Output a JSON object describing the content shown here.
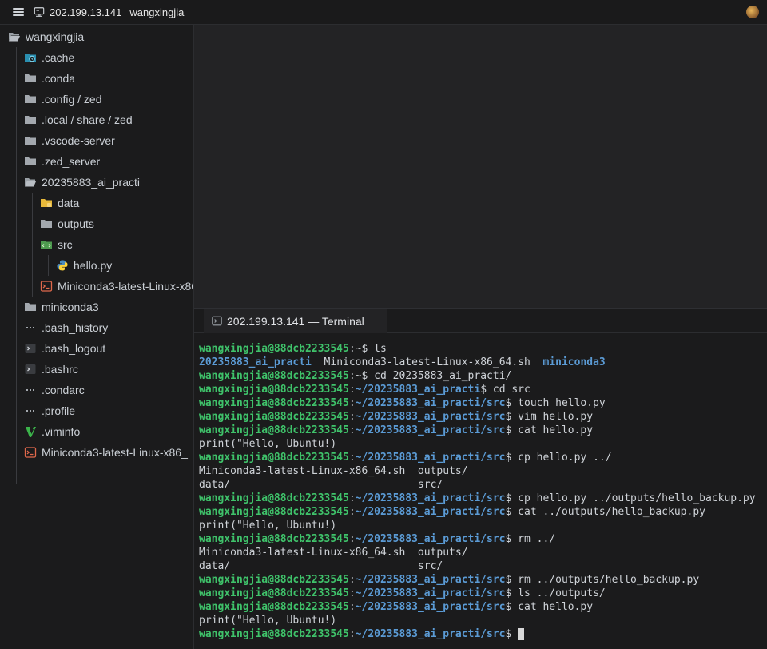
{
  "titlebar": {
    "host": "202.199.13.141",
    "user": "wangxingjia"
  },
  "sidebar": {
    "root": "wangxingjia",
    "items": [
      {
        "label": ".cache",
        "icon": "cache-folder-icon"
      },
      {
        "label": ".conda",
        "icon": "folder-icon"
      },
      {
        "label": ".config / zed",
        "icon": "folder-icon"
      },
      {
        "label": ".local / share / zed",
        "icon": "folder-icon"
      },
      {
        "label": ".vscode-server",
        "icon": "folder-icon"
      },
      {
        "label": ".zed_server",
        "icon": "folder-icon"
      },
      {
        "label": "20235883_ai_practi",
        "icon": "folder-open-icon"
      },
      {
        "label": "data",
        "icon": "data-folder-icon"
      },
      {
        "label": "outputs",
        "icon": "folder-icon"
      },
      {
        "label": "src",
        "icon": "src-folder-icon"
      },
      {
        "label": "hello.py",
        "icon": "python-icon"
      },
      {
        "label": "Miniconda3-latest-Linux-x86",
        "icon": "shell-script-icon"
      },
      {
        "label": "miniconda3",
        "icon": "folder-icon"
      },
      {
        "label": ".bash_history",
        "icon": "history-file-icon"
      },
      {
        "label": ".bash_logout",
        "icon": "terminal-file-icon"
      },
      {
        "label": ".bashrc",
        "icon": "terminal-file-icon"
      },
      {
        "label": ".condarc",
        "icon": "config-file-icon"
      },
      {
        "label": ".profile",
        "icon": "config-file-icon"
      },
      {
        "label": ".viminfo",
        "icon": "vim-icon"
      },
      {
        "label": "Miniconda3-latest-Linux-x86_",
        "icon": "shell-script-icon"
      }
    ]
  },
  "terminal": {
    "tab_label": "202.199.13.141 — Terminal",
    "lines": [
      [
        {
          "t": "wangxingjia@88dcb2233545",
          "c": "user"
        },
        {
          "t": ":~$ ls",
          "c": "out"
        }
      ],
      [
        {
          "t": "20235883_ai_practi",
          "c": "dir"
        },
        {
          "t": "  Miniconda3-latest-Linux-x86_64.sh  ",
          "c": "out"
        },
        {
          "t": "miniconda3",
          "c": "dir"
        }
      ],
      [
        {
          "t": "wangxingjia@88dcb2233545",
          "c": "user"
        },
        {
          "t": ":~$ cd 20235883_ai_practi/",
          "c": "out"
        }
      ],
      [
        {
          "t": "wangxingjia@88dcb2233545",
          "c": "user"
        },
        {
          "t": ":",
          "c": "out"
        },
        {
          "t": "~/20235883_ai_practi",
          "c": "path"
        },
        {
          "t": "$ cd src",
          "c": "out"
        }
      ],
      [
        {
          "t": "wangxingjia@88dcb2233545",
          "c": "user"
        },
        {
          "t": ":",
          "c": "out"
        },
        {
          "t": "~/20235883_ai_practi/src",
          "c": "path"
        },
        {
          "t": "$ touch hello.py",
          "c": "out"
        }
      ],
      [
        {
          "t": "wangxingjia@88dcb2233545",
          "c": "user"
        },
        {
          "t": ":",
          "c": "out"
        },
        {
          "t": "~/20235883_ai_practi/src",
          "c": "path"
        },
        {
          "t": "$ vim hello.py",
          "c": "out"
        }
      ],
      [
        {
          "t": "wangxingjia@88dcb2233545",
          "c": "user"
        },
        {
          "t": ":",
          "c": "out"
        },
        {
          "t": "~/20235883_ai_practi/src",
          "c": "path"
        },
        {
          "t": "$ cat hello.py",
          "c": "out"
        }
      ],
      [
        {
          "t": "print(\"Hello, Ubuntu!)",
          "c": "out"
        }
      ],
      [
        {
          "t": "wangxingjia@88dcb2233545",
          "c": "user"
        },
        {
          "t": ":",
          "c": "out"
        },
        {
          "t": "~/20235883_ai_practi/src",
          "c": "path"
        },
        {
          "t": "$ cp hello.py ../",
          "c": "out"
        }
      ],
      [
        {
          "t": "Miniconda3-latest-Linux-x86_64.sh  outputs/",
          "c": "out"
        }
      ],
      [
        {
          "t": "data/                              src/",
          "c": "out"
        }
      ],
      [
        {
          "t": "wangxingjia@88dcb2233545",
          "c": "user"
        },
        {
          "t": ":",
          "c": "out"
        },
        {
          "t": "~/20235883_ai_practi/src",
          "c": "path"
        },
        {
          "t": "$ cp hello.py ../outputs/hello_backup.py",
          "c": "out"
        }
      ],
      [
        {
          "t": "wangxingjia@88dcb2233545",
          "c": "user"
        },
        {
          "t": ":",
          "c": "out"
        },
        {
          "t": "~/20235883_ai_practi/src",
          "c": "path"
        },
        {
          "t": "$ cat ../outputs/hello_backup.py",
          "c": "out"
        }
      ],
      [
        {
          "t": "print(\"Hello, Ubuntu!)",
          "c": "out"
        }
      ],
      [
        {
          "t": "wangxingjia@88dcb2233545",
          "c": "user"
        },
        {
          "t": ":",
          "c": "out"
        },
        {
          "t": "~/20235883_ai_practi/src",
          "c": "path"
        },
        {
          "t": "$ rm ../",
          "c": "out"
        }
      ],
      [
        {
          "t": "Miniconda3-latest-Linux-x86_64.sh  outputs/",
          "c": "out"
        }
      ],
      [
        {
          "t": "data/                              src/",
          "c": "out"
        }
      ],
      [
        {
          "t": "wangxingjia@88dcb2233545",
          "c": "user"
        },
        {
          "t": ":",
          "c": "out"
        },
        {
          "t": "~/20235883_ai_practi/src",
          "c": "path"
        },
        {
          "t": "$ rm ../outputs/hello_backup.py",
          "c": "out"
        }
      ],
      [
        {
          "t": "wangxingjia@88dcb2233545",
          "c": "user"
        },
        {
          "t": ":",
          "c": "out"
        },
        {
          "t": "~/20235883_ai_practi/src",
          "c": "path"
        },
        {
          "t": "$ ls ../outputs/",
          "c": "out"
        }
      ],
      [
        {
          "t": "wangxingjia@88dcb2233545",
          "c": "user"
        },
        {
          "t": ":",
          "c": "out"
        },
        {
          "t": "~/20235883_ai_practi/src",
          "c": "path"
        },
        {
          "t": "$ cat hello.py",
          "c": "out"
        }
      ],
      [
        {
          "t": "print(\"Hello, Ubuntu!)",
          "c": "out"
        }
      ],
      [
        {
          "t": "wangxingjia@88dcb2233545",
          "c": "user"
        },
        {
          "t": ":",
          "c": "out"
        },
        {
          "t": "~/20235883_ai_practi/src",
          "c": "path"
        },
        {
          "t": "$ ",
          "c": "out"
        }
      ]
    ]
  },
  "colors": {
    "user": "#3fc26a",
    "path": "#5b9bd5",
    "text": "#cfd3d8",
    "background": "#1b1b1c"
  }
}
